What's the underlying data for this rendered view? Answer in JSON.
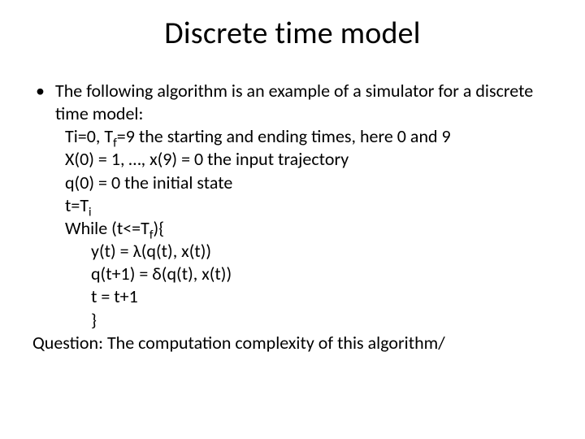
{
  "title": "Discrete time model",
  "bullet": "•",
  "lines": {
    "intro": "The following algorithm is an example of a simulator for a discrete time model:",
    "l1_pre": "Ti=0, T",
    "l1_sub": "f",
    "l1_post": "=9 the starting and ending times, here 0 and 9",
    "l2": "X(0) = 1, …, x(9) = 0 the input trajectory",
    "l3": "q(0) = 0 the initial state",
    "l4_pre": "t=T",
    "l4_sub": "i",
    "l5_pre": "While (t<=T",
    "l5_sub": "f",
    "l5_post": "){",
    "l6": "y(t) = λ(q(t), x(t))",
    "l7": "q(t+1) = δ(q(t), x(t))",
    "l8": "t = t+1",
    "l9": "}",
    "question": "Question: The computation complexity of this algorithm/"
  }
}
